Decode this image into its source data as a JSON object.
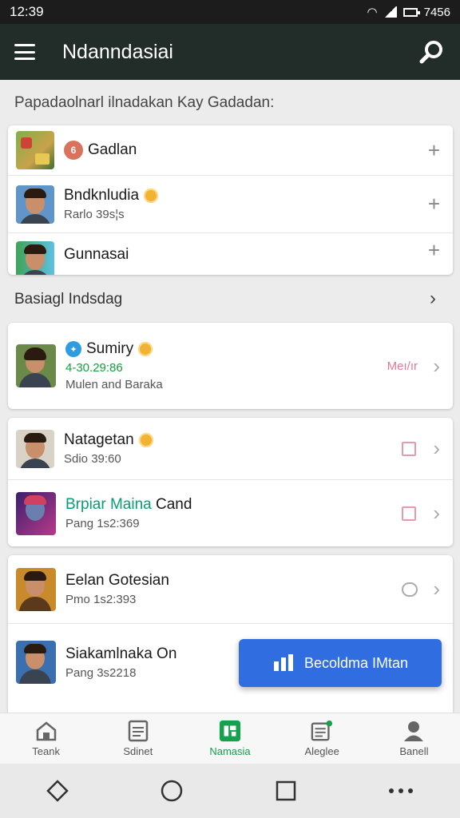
{
  "status": {
    "time": "12:39",
    "right": "7456"
  },
  "appbar": {
    "title": "Ndanndasiai"
  },
  "suggest_label": "Papadaolnarl ilnadakan Kay Gadadan:",
  "suggest": [
    {
      "name": "Gadlan",
      "sub": ""
    },
    {
      "name": "Bndknludia",
      "sub": "Rarlo 39s¦s"
    },
    {
      "name": "Gunnasai",
      "sub": ""
    }
  ],
  "section2_label": "Basiagl Indsdag",
  "featured": {
    "name": "Sumiry",
    "score": "4-30.29:86",
    "sub": "Mulen and Baraka",
    "meta": "Meı/ır"
  },
  "group1": [
    {
      "name": "Natagetan",
      "sub": "Sdio 39:60"
    },
    {
      "name_green": "Brpiar Maina",
      "name_rest": " Cand",
      "sub": "Pang 1s2:369"
    }
  ],
  "group2": [
    {
      "name": "Eelan Gotesian",
      "sub": "Pmo 1s2:393"
    },
    {
      "name": "Siakamlnaka On",
      "sub": "Pang 3s2218"
    }
  ],
  "fab_label": "Becoldma IMtan",
  "nav": [
    {
      "label": "Teank",
      "icon": "home-icon"
    },
    {
      "label": "Sdinet",
      "icon": "document-icon"
    },
    {
      "label": "Namasia",
      "icon": "grid-icon"
    },
    {
      "label": "Aleglee",
      "icon": "list-icon"
    },
    {
      "label": "Banell",
      "icon": "profile-icon"
    }
  ]
}
